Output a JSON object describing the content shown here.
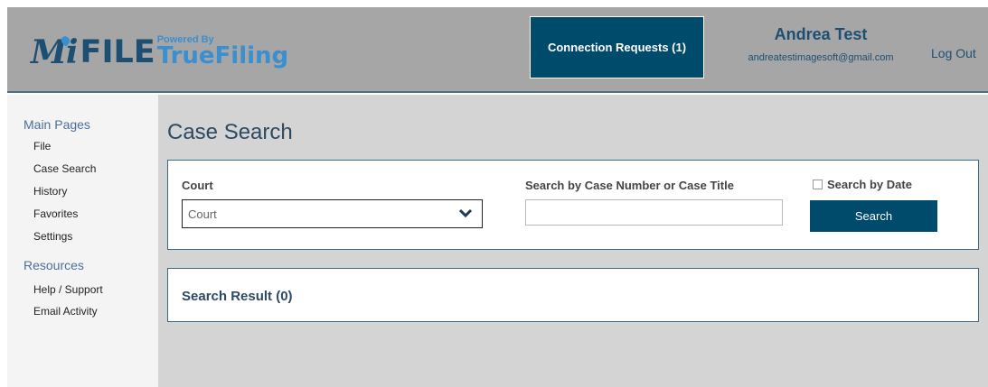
{
  "header": {
    "logo": {
      "mi": "Mi",
      "file": "FILE",
      "powered_by": "Powered By",
      "truefiling": "TrueFiling"
    },
    "connection_requests_label": "Connection Requests (1)",
    "user_name": "Andrea Test",
    "user_email": "andreatestimagesoft@gmail.com",
    "logout_label": "Log Out"
  },
  "sidebar": {
    "main_pages_heading": "Main Pages",
    "main_items": [
      {
        "label": "File"
      },
      {
        "label": "Case Search"
      },
      {
        "label": "History"
      },
      {
        "label": "Favorites"
      },
      {
        "label": "Settings"
      }
    ],
    "resources_heading": "Resources",
    "resource_items": [
      {
        "label": "Help / Support"
      },
      {
        "label": "Email Activity"
      }
    ]
  },
  "main": {
    "page_title": "Case Search",
    "court_label": "Court",
    "court_select_value": "Court",
    "search_label": "Search by Case Number or Case Title",
    "search_value": "",
    "search_by_date_label": "Search by Date",
    "search_by_date_checked": false,
    "search_button_label": "Search",
    "result_title": "Search Result (0)"
  },
  "colors": {
    "header_bg": "#a6a6a6",
    "brand_dark": "#1d4f73",
    "brand_light": "#3a8fd1",
    "button_bg": "#004a6b",
    "main_bg": "#d4d4d4",
    "panel_border": "#3b6a85"
  }
}
